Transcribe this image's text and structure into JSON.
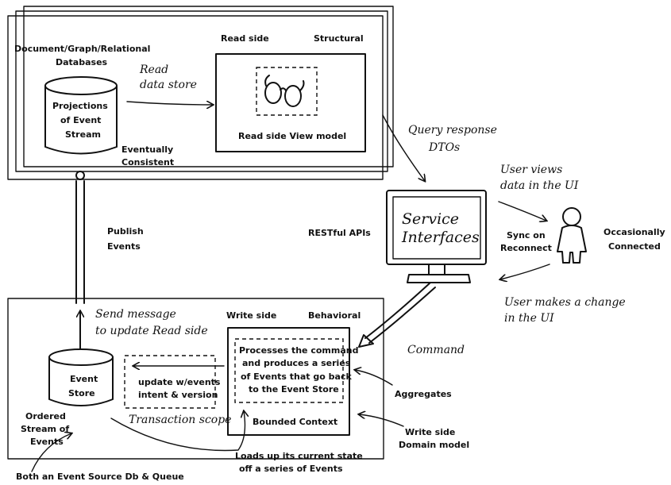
{
  "read_panel": {
    "db_title_1": "Document/Graph/Relational",
    "db_title_2": "Databases",
    "read_side": "Read side",
    "structural": "Structural",
    "read_store_1": "Read",
    "read_store_2": "data store",
    "projections_1": "Projections",
    "projections_2": "of Event",
    "projections_3": "Stream",
    "eventually_1": "Eventually",
    "eventually_2": "Consistent",
    "view_model": "Read side View model"
  },
  "middle": {
    "publish_1": "Publish",
    "publish_2": "Events",
    "restful": "RESTful APIs",
    "query_1": "Query response",
    "query_2": "DTOs",
    "service_1": "Service",
    "service_2": "Interfaces",
    "user_views_1": "User views",
    "user_views_2": "data in the UI",
    "sync_1": "Sync on",
    "sync_2": "Reconnect",
    "occasionally_1": "Occasionally",
    "occasionally_2": "Connected",
    "user_makes_1": "User makes a change",
    "user_makes_2": "in the UI",
    "command": "Command"
  },
  "write_panel": {
    "send_1": "Send message",
    "send_2": "to update Read side",
    "write_side": "Write side",
    "behavioral": "Behavioral",
    "process_1": "Processes the command",
    "process_2": "and produces a series",
    "process_3": "of Events that go back",
    "process_4": "to the Event Store",
    "event_store_1": "Event",
    "event_store_2": "Store",
    "update_1": "update w/events",
    "update_2": "intent & version",
    "transaction": "Transaction scope",
    "bounded": "Bounded Context",
    "ordered_1": "Ordered",
    "ordered_2": "Stream of",
    "ordered_3": "Events",
    "aggregates": "Aggregates",
    "domain_1": "Write side",
    "domain_2": "Domain model",
    "loads_1": "Loads up its current state",
    "loads_2": "off a series of Events",
    "both": "Both an Event Source Db & Queue"
  }
}
